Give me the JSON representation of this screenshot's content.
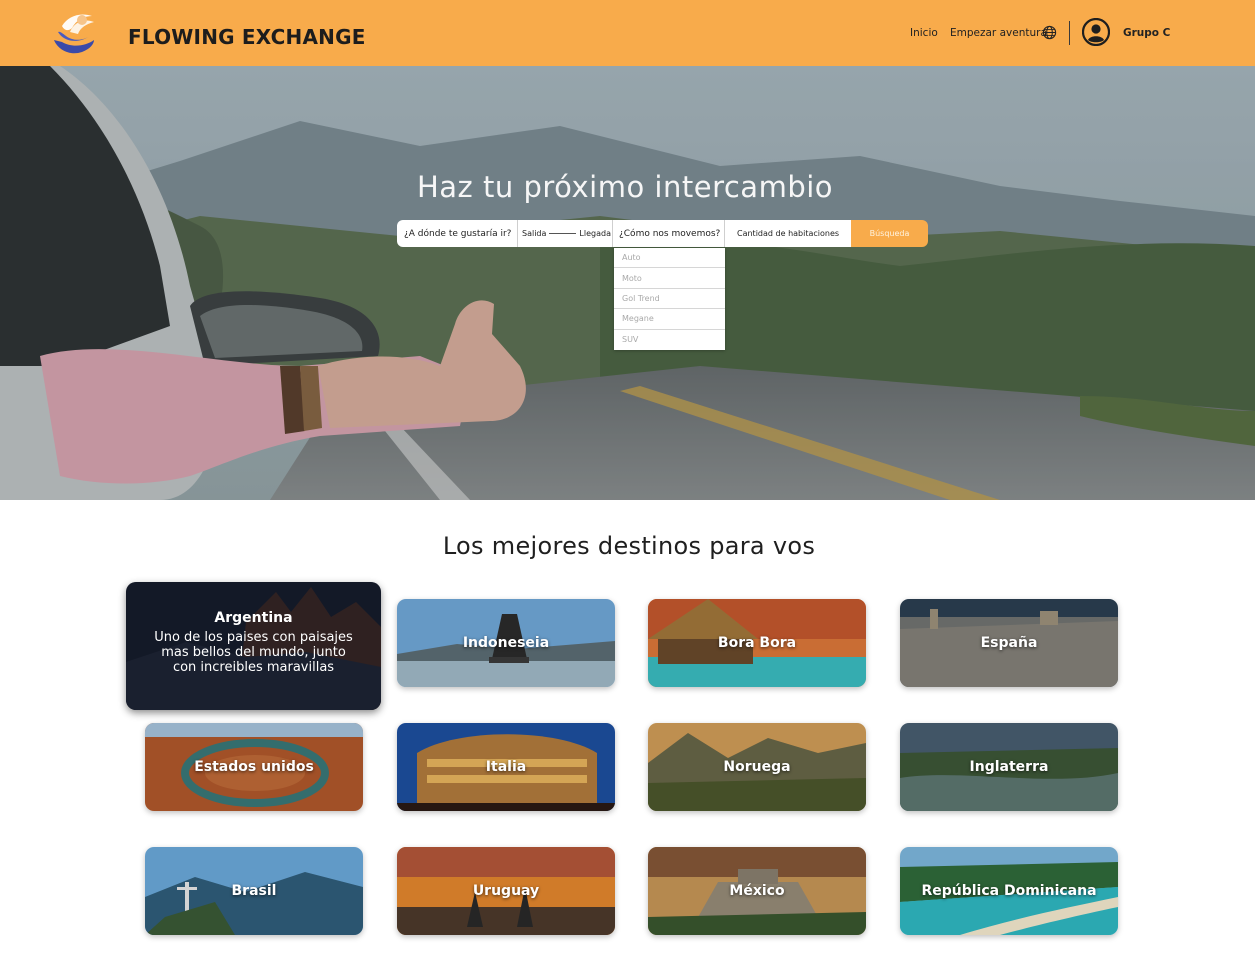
{
  "header": {
    "brand": "FLOWING EXCHANGE",
    "nav": {
      "inicio": "Inicio",
      "aventura": "Empezar aventura"
    },
    "user": "Grupo C",
    "icons": {
      "logo": "hands-logo-icon",
      "language": "globe-icon",
      "account": "user-avatar-icon"
    },
    "colors": {
      "bar": "#f8ab4b"
    }
  },
  "hero": {
    "title": "Haz tu próximo intercambio",
    "search": {
      "destination_placeholder": "¿A dónde te gustaría ir?",
      "departure": "Salida",
      "arrival": "Llegada",
      "transport": "¿Cómo nos movemos?",
      "rooms": "Cantidad de habitaciones",
      "button": "Búsqueda"
    },
    "transport_options": [
      "Auto",
      "Moto",
      "Gol Trend",
      "Megane",
      "SUV"
    ]
  },
  "destinations": {
    "title": "Los mejores destinos para vos",
    "featured": {
      "name": "Argentina",
      "description": "Uno de los paises con paisajes mas bellos del mundo, junto con increibles maravillas"
    },
    "cards": [
      "Indoneseia",
      "Bora Bora",
      "España",
      "Estados unidos",
      "Italia",
      "Noruega",
      "Inglaterra",
      "Brasil",
      "Uruguay",
      "México",
      "República Dominicana"
    ]
  }
}
